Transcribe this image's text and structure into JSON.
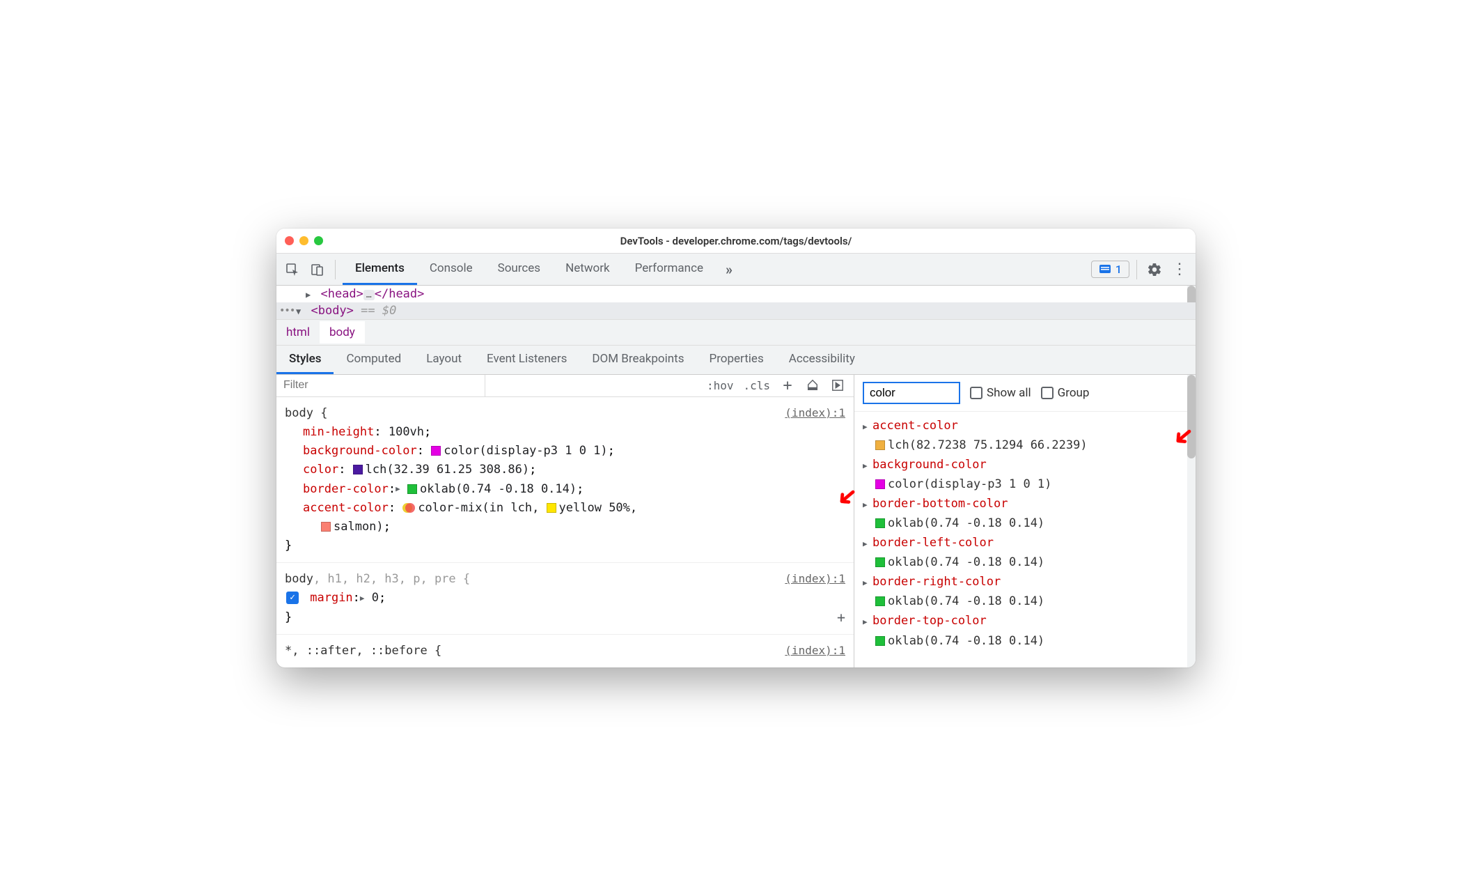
{
  "window": {
    "title": "DevTools - developer.chrome.com/tags/devtools/"
  },
  "mainTabs": {
    "items": [
      {
        "label": "Elements",
        "active": true
      },
      {
        "label": "Console"
      },
      {
        "label": "Sources"
      },
      {
        "label": "Network"
      },
      {
        "label": "Performance"
      }
    ],
    "issues_count": "1"
  },
  "dom": {
    "head_open": "<head>",
    "head_close": "</head>",
    "ellipsis": "…",
    "body_open": "<body>",
    "selected_marker": "== $0"
  },
  "breadcrumb": {
    "items": [
      {
        "label": "html"
      },
      {
        "label": "body",
        "active": true
      }
    ]
  },
  "subTabs": {
    "items": [
      {
        "label": "Styles",
        "active": true
      },
      {
        "label": "Computed"
      },
      {
        "label": "Layout"
      },
      {
        "label": "Event Listeners"
      },
      {
        "label": "DOM Breakpoints"
      },
      {
        "label": "Properties"
      },
      {
        "label": "Accessibility"
      }
    ]
  },
  "styles": {
    "filter_placeholder": "Filter",
    "hov": ":hov",
    "cls": ".cls",
    "rules": [
      {
        "selector_main": "body",
        "selector_rest": " {",
        "source": "(index):1",
        "props": [
          {
            "name": "min-height",
            "value": "100vh"
          },
          {
            "name": "background-color",
            "value": "color(display-p3 1 0 1)",
            "swatch": "#e400e4"
          },
          {
            "name": "color",
            "value": "lch(32.39 61.25 308.86)",
            "swatch": "#4b1aa1"
          },
          {
            "name": "border-color",
            "value": "oklab(0.74 -0.18 0.14)",
            "swatch": "#1fbf3a",
            "expandable": true
          },
          {
            "name": "accent-color",
            "value_pre": "color-mix(in lch, ",
            "value_mid_swatch": "#ffe600",
            "value_mid": "yellow 50%,",
            "value_line2_swatch": "#fa8072",
            "value_line2": "salmon)",
            "mix": true
          }
        ]
      },
      {
        "selector_main": "body",
        "selector_rest": ", h1, h2, h3, p, pre {",
        "source": "(index):1",
        "props": [
          {
            "name": "margin",
            "value": "0",
            "checked": true,
            "expandable": true
          }
        ]
      },
      {
        "selector_main": "*, ::after, ::before",
        "selector_rest": " {",
        "source": "(index):1",
        "props": []
      }
    ]
  },
  "computed": {
    "filter_value": "color",
    "show_all": "Show all",
    "group": "Group",
    "items": [
      {
        "name": "accent-color",
        "value": "lch(82.7238 75.1294 66.2239)",
        "swatch": "#f0b040"
      },
      {
        "name": "background-color",
        "value": "color(display-p3 1 0 1)",
        "swatch": "#e400e4"
      },
      {
        "name": "border-bottom-color",
        "value": "oklab(0.74 -0.18 0.14)",
        "swatch": "#1fbf3a"
      },
      {
        "name": "border-left-color",
        "value": "oklab(0.74 -0.18 0.14)",
        "swatch": "#1fbf3a"
      },
      {
        "name": "border-right-color",
        "value": "oklab(0.74 -0.18 0.14)",
        "swatch": "#1fbf3a"
      },
      {
        "name": "border-top-color",
        "value": "oklab(0.74 -0.18 0.14)",
        "swatch": "#1fbf3a"
      }
    ]
  }
}
